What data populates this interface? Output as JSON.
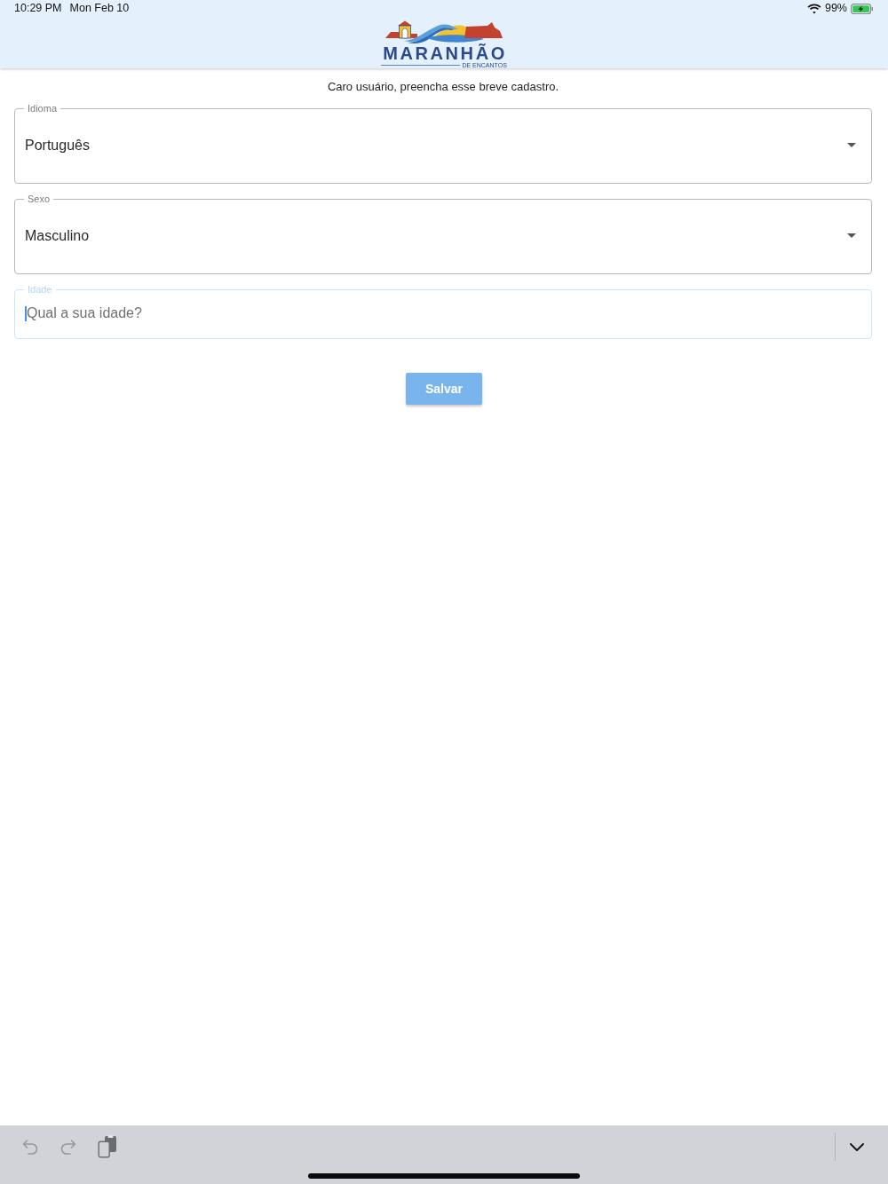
{
  "status_bar": {
    "time": "10:29 PM",
    "date": "Mon Feb 10",
    "battery": "99%",
    "charging": true
  },
  "header": {
    "logo": {
      "title": "MARANHÃO",
      "subtitle": "DE ENCANTOS"
    }
  },
  "form": {
    "intro": "Caro usuário, preencha esse breve cadastro.",
    "fields": [
      {
        "kind": "select",
        "label": "Idioma",
        "value": "Português",
        "focused": false
      },
      {
        "kind": "select",
        "label": "Sexo",
        "value": "Masculino",
        "focused": false
      },
      {
        "kind": "text",
        "label": "Idade",
        "placeholder": "Qual a sua idade?",
        "focused": true
      }
    ],
    "submit": {
      "label": "Salvar",
      "disabled": true
    }
  },
  "keyboard_toolbar": {
    "left_buttons": [
      {
        "kind": "undo",
        "disabled": true
      },
      {
        "kind": "redo",
        "disabled": true
      },
      {
        "kind": "paste",
        "disabled": false
      }
    ],
    "right_buttons": [
      {
        "kind": "dismiss",
        "disabled": false
      }
    ]
  }
}
